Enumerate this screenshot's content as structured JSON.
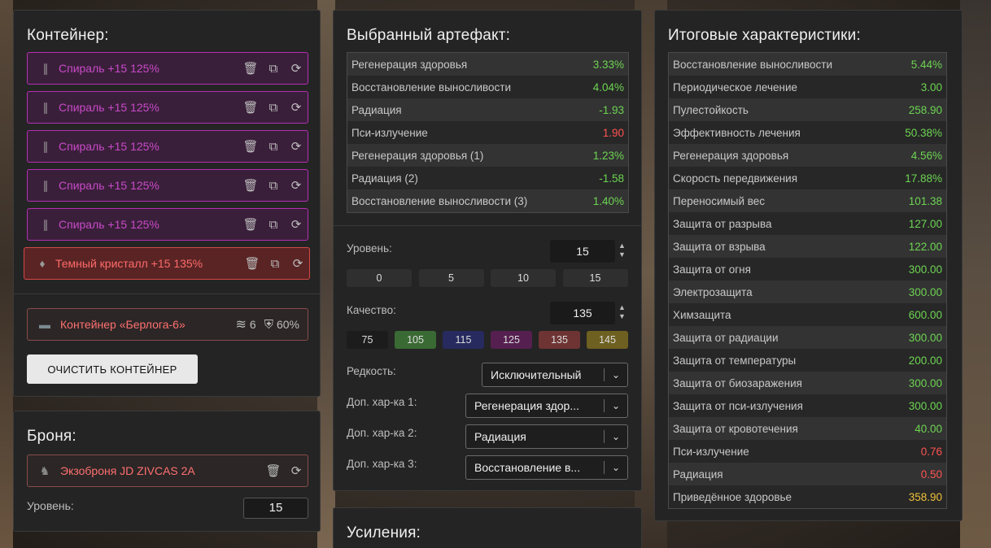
{
  "container": {
    "title": "Контейнер:",
    "items": [
      {
        "label": "Спираль +15 125%",
        "icon": "spiral-artifact-icon"
      },
      {
        "label": "Спираль +15 125%",
        "icon": "spiral-artifact-icon"
      },
      {
        "label": "Спираль +15 125%",
        "icon": "spiral-artifact-icon"
      },
      {
        "label": "Спираль +15 125%",
        "icon": "spiral-artifact-icon"
      },
      {
        "label": "Спираль +15 125%",
        "icon": "spiral-artifact-icon"
      },
      {
        "label": "Темный кристалл +15 135%",
        "icon": "dark-crystal-artifact-icon"
      }
    ],
    "container_item": {
      "label": "Контейнер «Берлога-6»",
      "slots": "6",
      "protection": "60%"
    },
    "clear_button": "ОЧИСТИТЬ КОНТЕЙНЕР"
  },
  "armor": {
    "title": "Броня:",
    "item": "Экзоброня JD ZIVCAS 2A",
    "level_label": "Уровень:",
    "level_value": "15"
  },
  "artifact": {
    "title": "Выбранный артефакт:",
    "stats": [
      {
        "name": "Регенерация здоровья",
        "value": "3.33%",
        "color": "green"
      },
      {
        "name": "Восстановление выносливости",
        "value": "4.04%",
        "color": "green"
      },
      {
        "name": "Радиация",
        "value": "-1.93",
        "color": "green"
      },
      {
        "name": "Пси-излучение",
        "value": "1.90",
        "color": "red"
      },
      {
        "name": "Регенерация здоровья (1)",
        "value": "1.23%",
        "color": "green"
      },
      {
        "name": "Радиация (2)",
        "value": "-1.58",
        "color": "green"
      },
      {
        "name": "Восстановление выносливости (3)",
        "value": "1.40%",
        "color": "green"
      }
    ],
    "level_label": "Уровень:",
    "level_value": "15",
    "level_presets": [
      "0",
      "5",
      "10",
      "15"
    ],
    "quality_label": "Качество:",
    "quality_value": "135",
    "quality_presets": [
      {
        "label": "75",
        "color": "#1c1c1c"
      },
      {
        "label": "105",
        "color": "#3a6a34"
      },
      {
        "label": "115",
        "color": "#262a5e"
      },
      {
        "label": "125",
        "color": "#55204f"
      },
      {
        "label": "135",
        "color": "#6e3434"
      },
      {
        "label": "145",
        "color": "#6e6020"
      }
    ],
    "rarity_label": "Редкость:",
    "rarity_value": "Исключительный",
    "extra1_label": "Доп. хар-ка 1:",
    "extra1_value": "Регенерация здор...",
    "extra2_label": "Доп. хар-ка 2:",
    "extra2_value": "Радиация",
    "extra3_label": "Доп. хар-ка 3:",
    "extra3_value": "Восстановление в..."
  },
  "boosts": {
    "title": "Усиления:"
  },
  "totals": {
    "title": "Итоговые характеристики:",
    "stats": [
      {
        "name": "Восстановление выносливости",
        "value": "5.44%",
        "color": "green"
      },
      {
        "name": "Периодическое лечение",
        "value": "3.00",
        "color": "green"
      },
      {
        "name": "Пулестойкость",
        "value": "258.90",
        "color": "green"
      },
      {
        "name": "Эффективность лечения",
        "value": "50.38%",
        "color": "green"
      },
      {
        "name": "Регенерация здоровья",
        "value": "4.56%",
        "color": "green"
      },
      {
        "name": "Скорость передвижения",
        "value": "17.88%",
        "color": "green"
      },
      {
        "name": "Переносимый вес",
        "value": "101.38",
        "color": "green"
      },
      {
        "name": "Защита от разрыва",
        "value": "127.00",
        "color": "green"
      },
      {
        "name": "Защита от взрыва",
        "value": "122.00",
        "color": "green"
      },
      {
        "name": "Защита от огня",
        "value": "300.00",
        "color": "green"
      },
      {
        "name": "Электрозащита",
        "value": "300.00",
        "color": "green"
      },
      {
        "name": "Химзащита",
        "value": "600.00",
        "color": "green"
      },
      {
        "name": "Защита от радиации",
        "value": "300.00",
        "color": "green"
      },
      {
        "name": "Защита от температуры",
        "value": "200.00",
        "color": "green"
      },
      {
        "name": "Защита от биозаражения",
        "value": "300.00",
        "color": "green"
      },
      {
        "name": "Защита от пси-излучения",
        "value": "300.00",
        "color": "green"
      },
      {
        "name": "Защита от кровотечения",
        "value": "40.00",
        "color": "green"
      },
      {
        "name": "Пси-излучение",
        "value": "0.76",
        "color": "red"
      },
      {
        "name": "Радиация",
        "value": "0.50",
        "color": "red"
      },
      {
        "name": "Приведённое здоровье",
        "value": "358.90",
        "color": "yellow"
      }
    ]
  }
}
